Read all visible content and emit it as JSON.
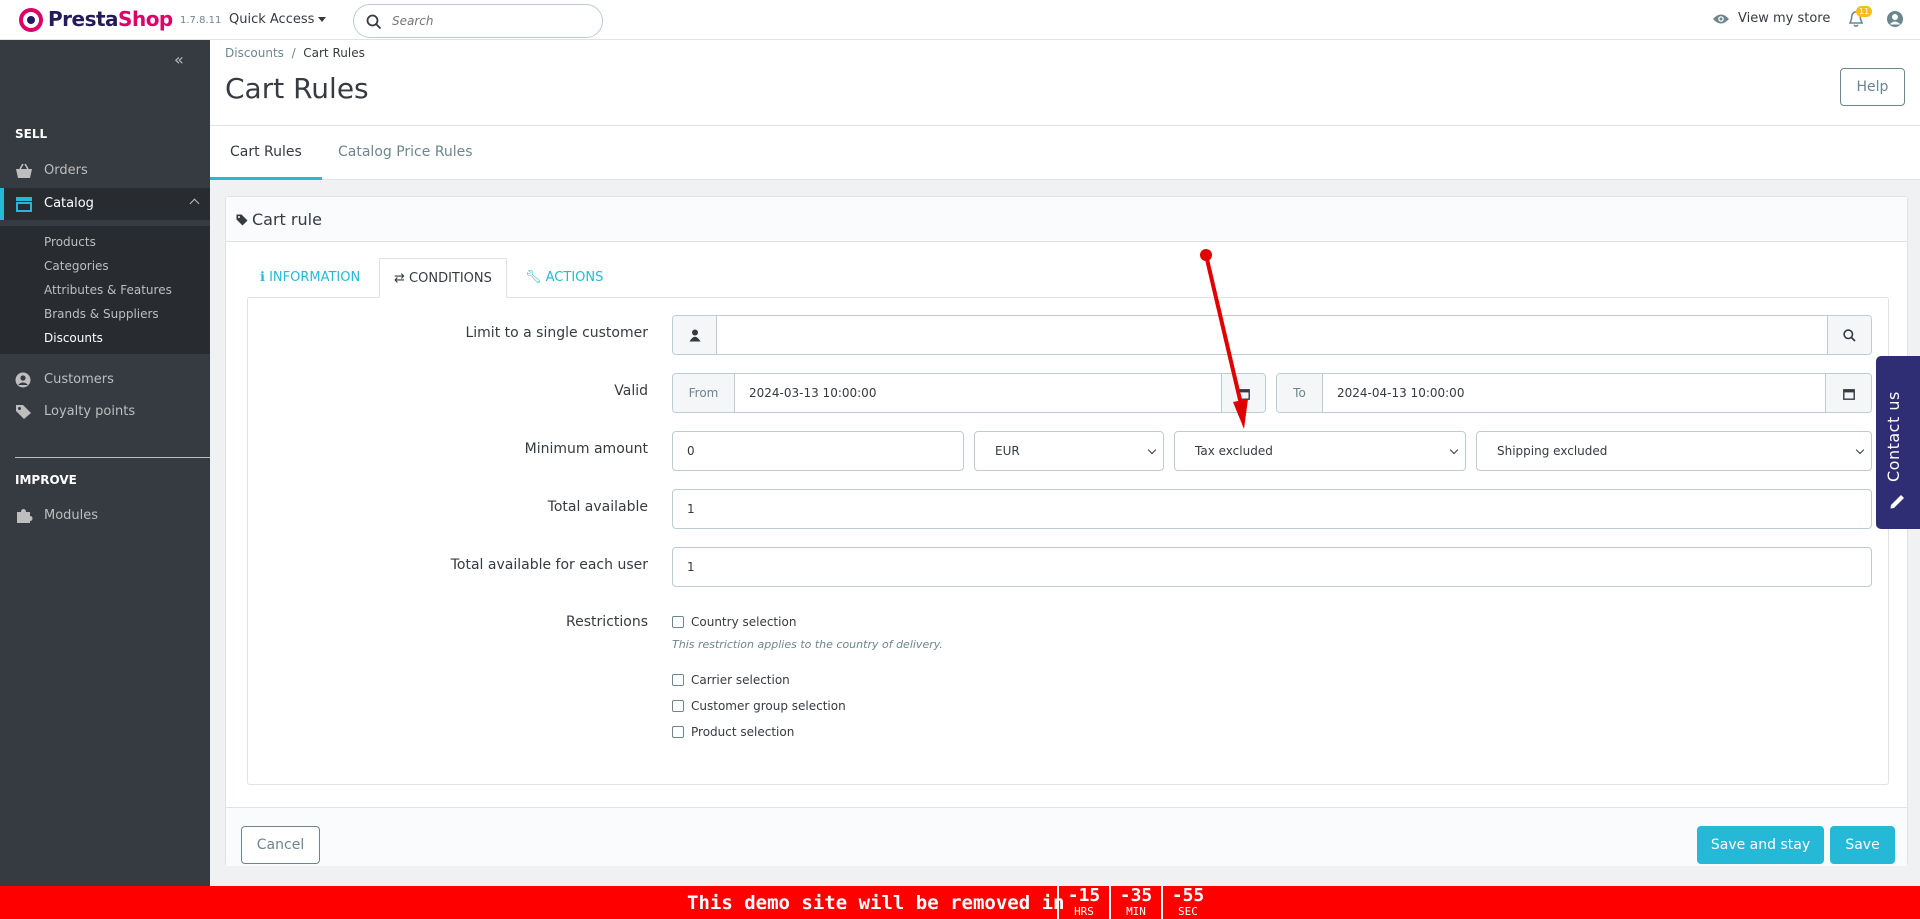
{
  "header": {
    "brand_part1": "Presta",
    "brand_part2": "Shop",
    "version": "1.7.8.11",
    "quick_access_label": "Quick Access",
    "search_placeholder": "Search",
    "view_store_label": "View my store",
    "notifications_count": "11"
  },
  "sidebar": {
    "sections": [
      {
        "title": "SELL"
      },
      {
        "title": "IMPROVE"
      }
    ],
    "items": [
      {
        "label": "Orders",
        "icon": "basket-icon"
      },
      {
        "label": "Catalog",
        "icon": "store-icon"
      },
      {
        "label": "Customers",
        "icon": "person-icon"
      },
      {
        "label": "Loyalty points",
        "icon": "tag-icon"
      },
      {
        "label": "Modules",
        "icon": "puzzle-icon"
      }
    ],
    "catalog_sub": [
      {
        "label": "Products"
      },
      {
        "label": "Categories"
      },
      {
        "label": "Attributes & Features"
      },
      {
        "label": "Brands & Suppliers"
      },
      {
        "label": "Discounts"
      }
    ]
  },
  "page": {
    "breadcrumb_parent": "Discounts",
    "breadcrumb_sep": "/",
    "breadcrumb_current": "Cart Rules",
    "title": "Cart Rules",
    "help_label": "Help",
    "tabs": [
      {
        "label": "Cart Rules"
      },
      {
        "label": "Catalog Price Rules"
      }
    ]
  },
  "panel": {
    "title": "Cart rule",
    "form_tabs": [
      {
        "label": "INFORMATION",
        "icon": "info-icon"
      },
      {
        "label": "CONDITIONS",
        "icon": "shuffle-icon"
      },
      {
        "label": "ACTIONS",
        "icon": "wrench-icon"
      }
    ],
    "fields": {
      "limit_label": "Limit to a single customer",
      "limit_value": "",
      "valid_label": "Valid",
      "from_label": "From",
      "from_value": "2024-03-13 10:00:00",
      "to_label": "To",
      "to_value": "2024-04-13 10:00:00",
      "min_amount_label": "Minimum amount",
      "min_amount_value": "0",
      "currency": "EUR",
      "tax": "Tax excluded",
      "shipping": "Shipping excluded",
      "total_available_label": "Total available",
      "total_available_value": "1",
      "total_each_user_label": "Total available for each user",
      "total_each_user_value": "1",
      "restrictions_label": "Restrictions",
      "country_selection": "Country selection",
      "country_hint": "This restriction applies to the country of delivery.",
      "carrier_selection": "Carrier selection",
      "customer_group_selection": "Customer group selection",
      "product_selection": "Product selection"
    },
    "buttons": {
      "cancel": "Cancel",
      "save_and_stay": "Save and stay",
      "save": "Save"
    }
  },
  "contact_tab": {
    "label": "Contact us"
  },
  "banner": {
    "message": "This demo site will be removed in",
    "hours": "-15",
    "hours_unit": "HRS",
    "minutes": "-35",
    "minutes_unit": "MIN",
    "seconds": "-55",
    "seconds_unit": "SEC"
  },
  "colors": {
    "accent": "#25b9d7",
    "sidebar": "#363a41",
    "brand_pink": "#df0067",
    "banner": "#ff0000",
    "annotation": "#e00000"
  }
}
